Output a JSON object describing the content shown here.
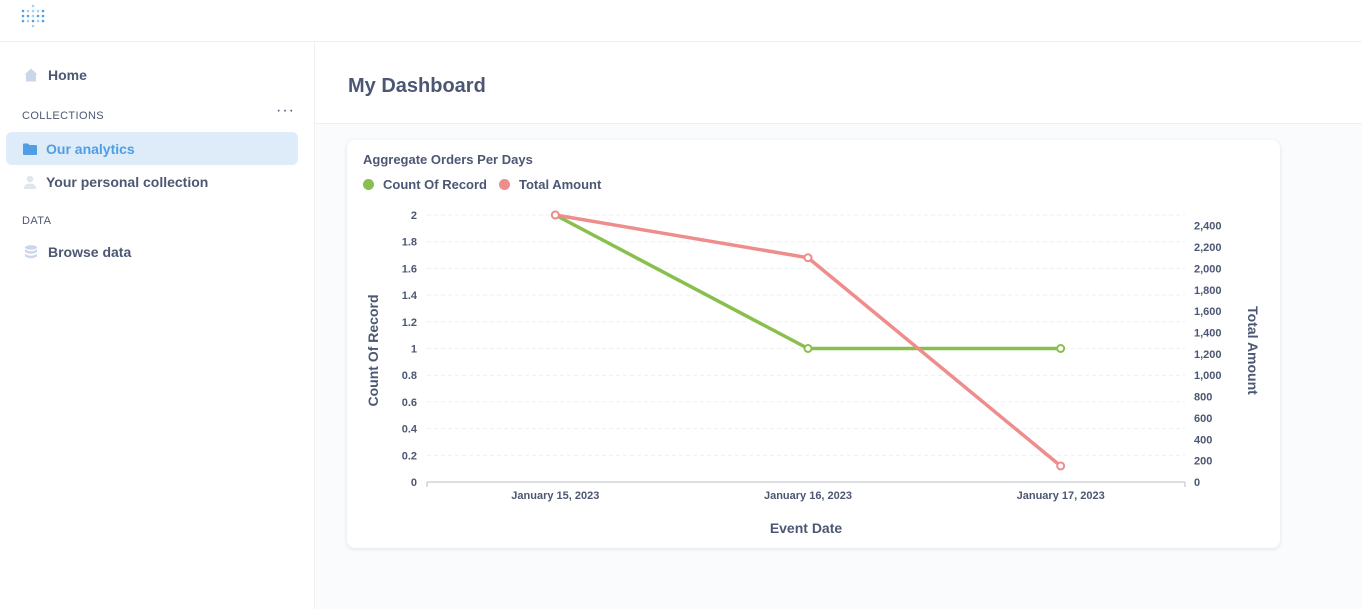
{
  "sidebar": {
    "home_label": "Home",
    "collections_title": "COLLECTIONS",
    "more_label": "···",
    "items": [
      {
        "label": "Our analytics",
        "icon": "folder-icon",
        "active": true
      },
      {
        "label": "Your personal collection",
        "icon": "person-icon",
        "active": false
      }
    ],
    "data_title": "DATA",
    "browse_label": "Browse data"
  },
  "header": {
    "title": "My Dashboard"
  },
  "card": {
    "title": "Aggregate Orders Per Days"
  },
  "colors": {
    "accent": "#509ee3",
    "series_count": "#88bf4d",
    "series_amount": "#ef8c8c",
    "text": "#4c5773"
  },
  "chart_data": {
    "type": "line",
    "title": "Aggregate Orders Per Days",
    "categories": [
      "January 15, 2023",
      "January 16, 2023",
      "January 17, 2023"
    ],
    "xlabel": "Event Date",
    "series": [
      {
        "name": "Count Of Record",
        "axis": "left",
        "color": "#88bf4d",
        "values": [
          2,
          1,
          1
        ]
      },
      {
        "name": "Total Amount",
        "axis": "right",
        "color": "#ef8c8c",
        "values": [
          2500,
          2100,
          150
        ]
      }
    ],
    "left_axis": {
      "label": "Count Of Record",
      "ylim": [
        0,
        2
      ],
      "ticks": [
        0,
        0.2,
        0.4,
        0.6,
        0.8,
        1,
        1.2,
        1.4,
        1.6,
        1.8,
        2
      ],
      "tick_labels": [
        "0",
        "0.2",
        "0.4",
        "0.6",
        "0.8",
        "1",
        "1.2",
        "1.4",
        "1.6",
        "1.8",
        "2"
      ]
    },
    "right_axis": {
      "label": "Total Amount",
      "ylim": [
        0,
        2500
      ],
      "ticks": [
        0,
        200,
        400,
        600,
        800,
        1000,
        1200,
        1400,
        1600,
        1800,
        2000,
        2200,
        2400
      ],
      "tick_labels": [
        "0",
        "200",
        "400",
        "600",
        "800",
        "1,000",
        "1,200",
        "1,400",
        "1,600",
        "1,800",
        "2,000",
        "2,200",
        "2,400"
      ]
    },
    "grid": true,
    "legend_position": "top-left"
  }
}
